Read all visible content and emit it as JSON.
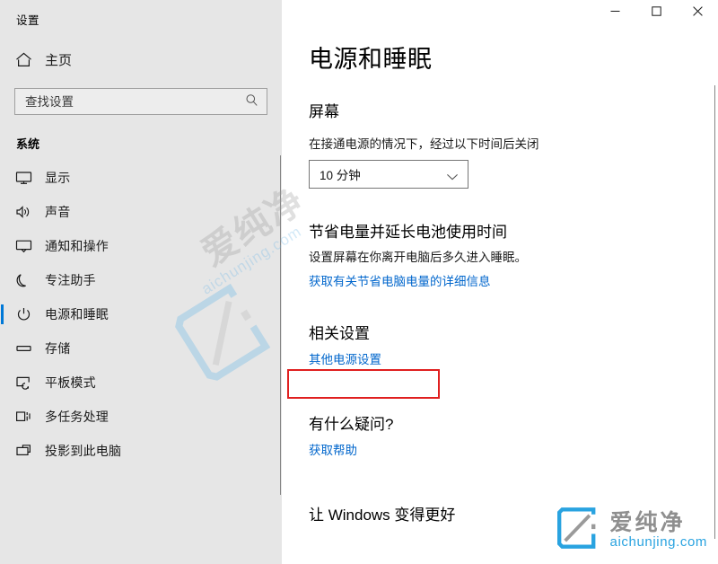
{
  "window": {
    "app_title": "设置",
    "controls": {
      "minimize": "最小化",
      "maximize": "最大化",
      "close": "关闭"
    }
  },
  "sidebar": {
    "home_label": "主页",
    "home_icon": "home-icon",
    "search": {
      "placeholder": "查找设置",
      "value": "",
      "icon": "search-icon"
    },
    "section_header": "系统",
    "items": [
      {
        "label": "显示",
        "icon": "monitor-icon",
        "selected": false
      },
      {
        "label": "声音",
        "icon": "speaker-icon",
        "selected": false
      },
      {
        "label": "通知和操作",
        "icon": "notification-icon",
        "selected": false
      },
      {
        "label": "专注助手",
        "icon": "moon-icon",
        "selected": false
      },
      {
        "label": "电源和睡眠",
        "icon": "power-icon",
        "selected": true
      },
      {
        "label": "存储",
        "icon": "storage-icon",
        "selected": false
      },
      {
        "label": "平板模式",
        "icon": "tablet-icon",
        "selected": false
      },
      {
        "label": "多任务处理",
        "icon": "multitask-icon",
        "selected": false
      },
      {
        "label": "投影到此电脑",
        "icon": "project-icon",
        "selected": false
      }
    ]
  },
  "main": {
    "page_title": "电源和睡眠",
    "screen_section": {
      "heading": "屏幕",
      "label": "在接通电源的情况下，经过以下时间后关闭",
      "dropdown_value": "10 分钟",
      "dropdown_icon": "chevron-down-icon"
    },
    "battery_section": {
      "heading": "节省电量并延长电池使用时间",
      "description": "设置屏幕在你离开电脑后多久进入睡眠。",
      "link": "获取有关节省电脑电量的详细信息"
    },
    "related_section": {
      "heading": "相关设置",
      "link": "其他电源设置"
    },
    "help_section": {
      "heading": "有什么疑问?",
      "link": "获取帮助"
    },
    "feedback_section": {
      "heading": "让 Windows 变得更好"
    }
  },
  "watermark": {
    "cn_text": "爱纯净",
    "domain_text": "aichunjing.com"
  },
  "colors": {
    "accent": "#0078d7",
    "link": "#0066cc",
    "highlight_box": "#e02020",
    "sidebar_bg": "#e6e6e6",
    "content_bg": "#ffffff",
    "watermark_blue": "#29a3e0"
  }
}
